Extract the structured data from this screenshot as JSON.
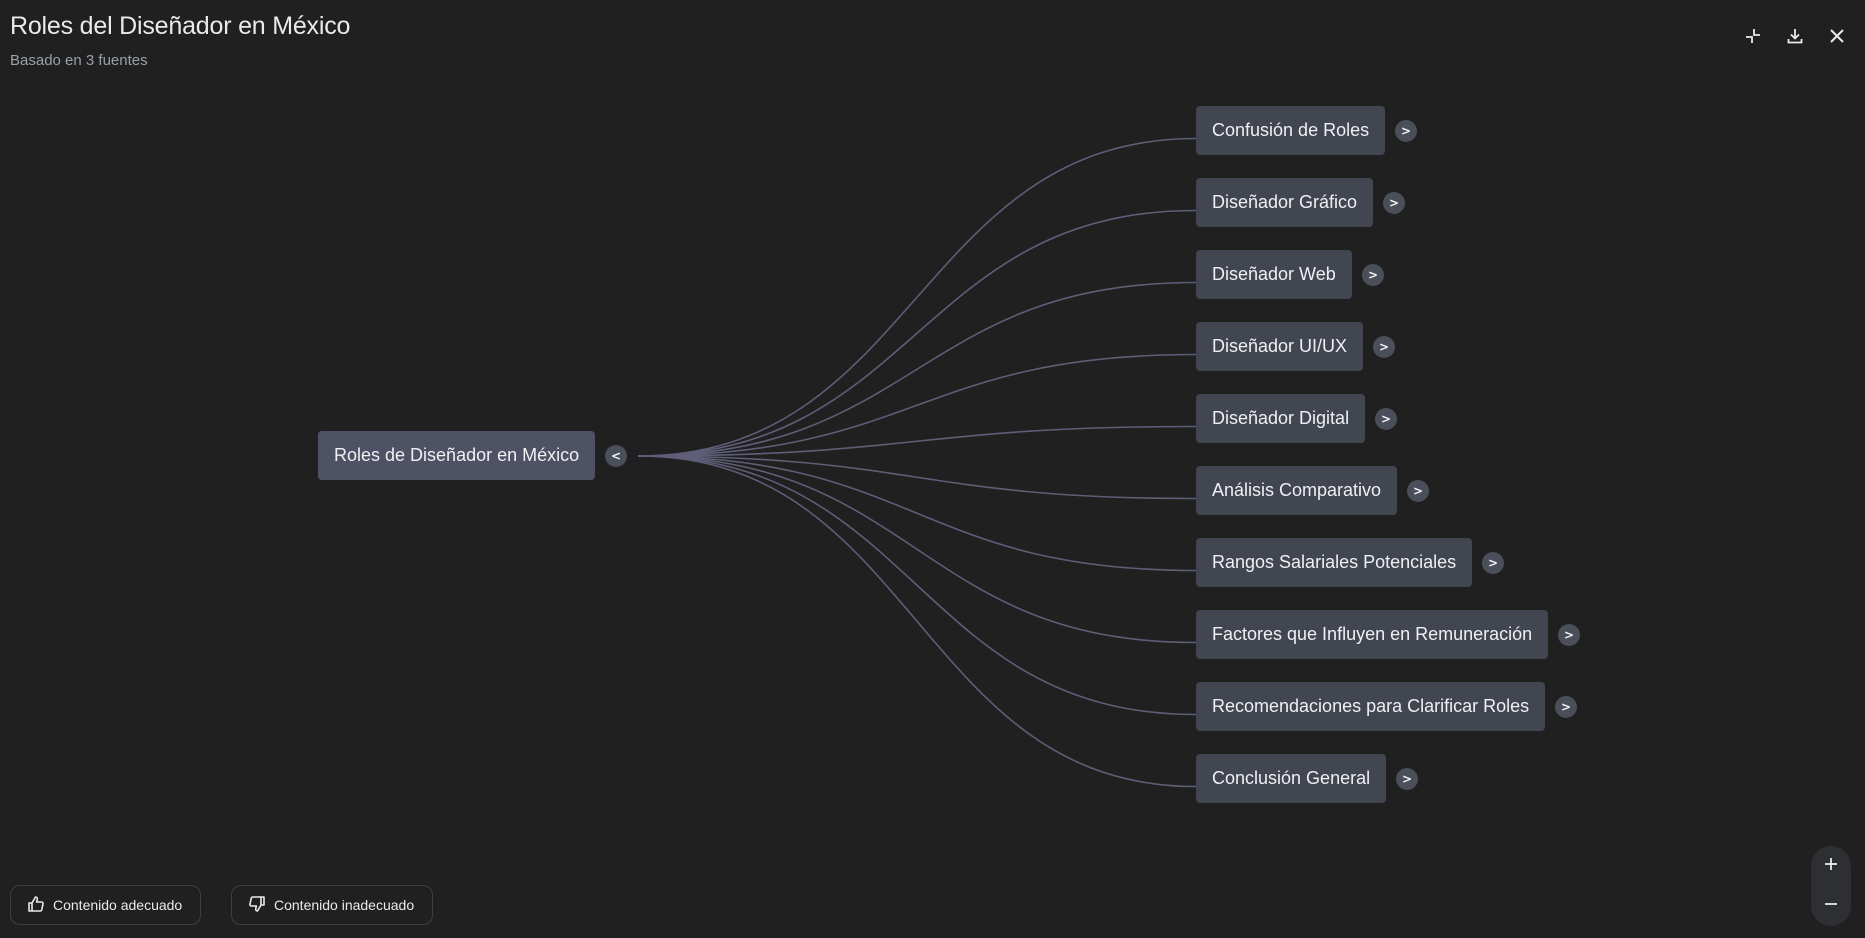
{
  "header": {
    "title": "Roles del Diseñador en México",
    "subtitle": "Basado en 3 fuentes"
  },
  "toolbar": {
    "collapse_icon": "collapse-icon",
    "download_icon": "download-icon",
    "close_icon": "close-icon"
  },
  "mindmap": {
    "root": {
      "label": "Roles de Diseñador en México",
      "toggle": "<"
    },
    "children": [
      {
        "label": "Confusión de Roles",
        "toggle": ">"
      },
      {
        "label": "Diseñador Gráfico",
        "toggle": ">"
      },
      {
        "label": "Diseñador Web",
        "toggle": ">"
      },
      {
        "label": "Diseñador UI/UX",
        "toggle": ">"
      },
      {
        "label": "Diseñador Digital",
        "toggle": ">"
      },
      {
        "label": "Análisis Comparativo",
        "toggle": ">"
      },
      {
        "label": "Rangos Salariales Potenciales",
        "toggle": ">"
      },
      {
        "label": "Factores que Influyen en Remuneración",
        "toggle": ">"
      },
      {
        "label": "Recomendaciones para Clarificar Roles",
        "toggle": ">"
      },
      {
        "label": "Conclusión General",
        "toggle": ">"
      }
    ]
  },
  "feedback": {
    "good_label": "Contenido adecuado",
    "bad_label": "Contenido inadecuado"
  },
  "zoom": {
    "in_icon": "plus-icon",
    "out_icon": "minus-icon"
  },
  "colors": {
    "background": "#202020",
    "node": "#414650",
    "root_node": "#4f5165",
    "link": "#5e5e78"
  }
}
